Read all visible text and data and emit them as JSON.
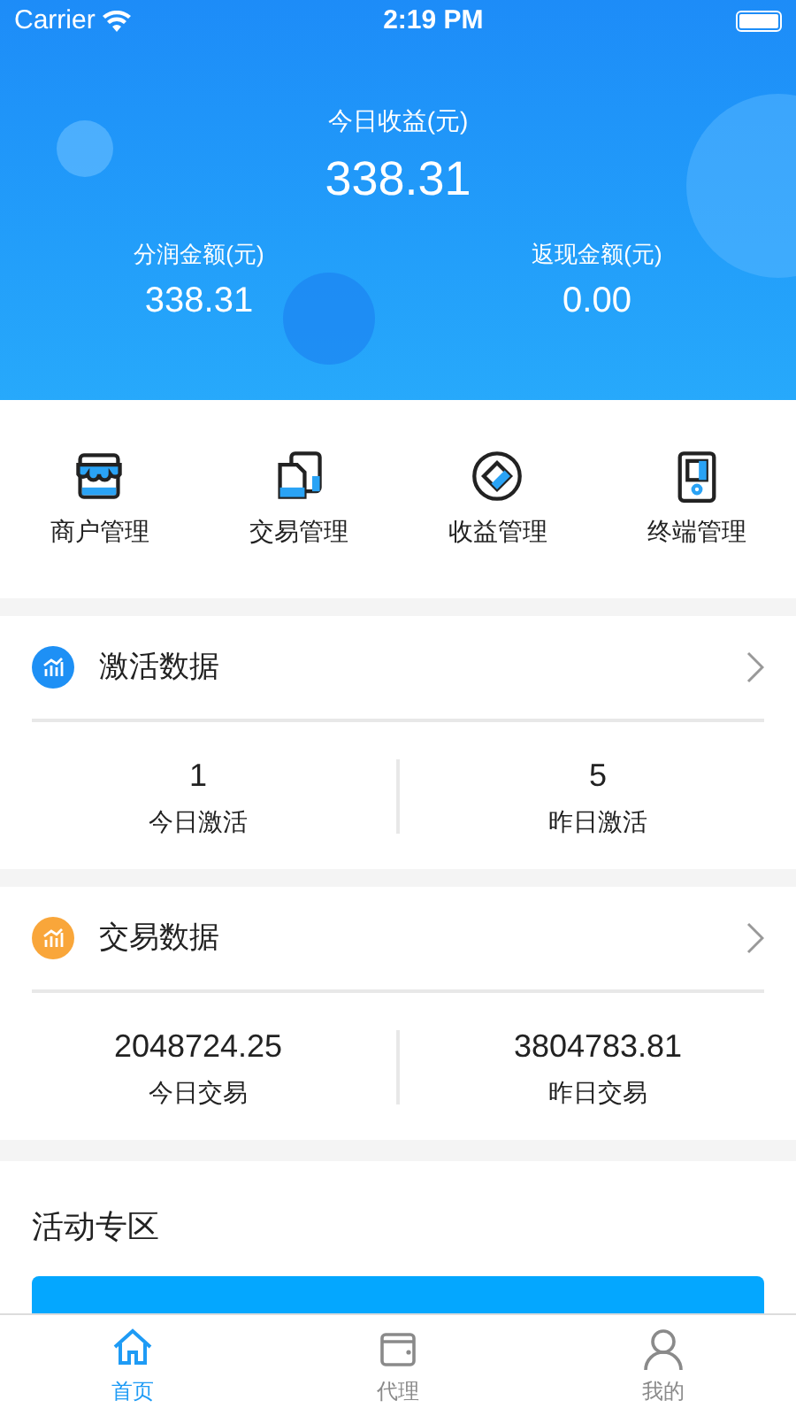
{
  "status_bar": {
    "carrier": "Carrier",
    "time": "2:19 PM"
  },
  "header": {
    "title": "今日收益(元)",
    "amount": "338.31",
    "stats": [
      {
        "label": "分润金额(元)",
        "value": "338.31"
      },
      {
        "label": "返现金额(元)",
        "value": "0.00"
      }
    ]
  },
  "menu": [
    {
      "label": "商户管理",
      "kind": "shop"
    },
    {
      "label": "交易管理",
      "kind": "docs"
    },
    {
      "label": "收益管理",
      "kind": "coin"
    },
    {
      "label": "终端管理",
      "kind": "device"
    }
  ],
  "sections": [
    {
      "title": "激活数据",
      "color": "#1e90f5",
      "items": [
        {
          "value": "1",
          "label": "今日激活"
        },
        {
          "value": "5",
          "label": "昨日激活"
        }
      ]
    },
    {
      "title": "交易数据",
      "color": "#f9a63a",
      "items": [
        {
          "value": "2048724.25",
          "label": "今日交易"
        },
        {
          "value": "3804783.81",
          "label": "昨日交易"
        }
      ]
    }
  ],
  "activity": {
    "title": "活动专区"
  },
  "tab_bar": [
    {
      "label": "首页",
      "kind": "home",
      "selected": true
    },
    {
      "label": "代理",
      "kind": "wallet",
      "selected": false
    },
    {
      "label": "我的",
      "kind": "person",
      "selected": false
    }
  ]
}
